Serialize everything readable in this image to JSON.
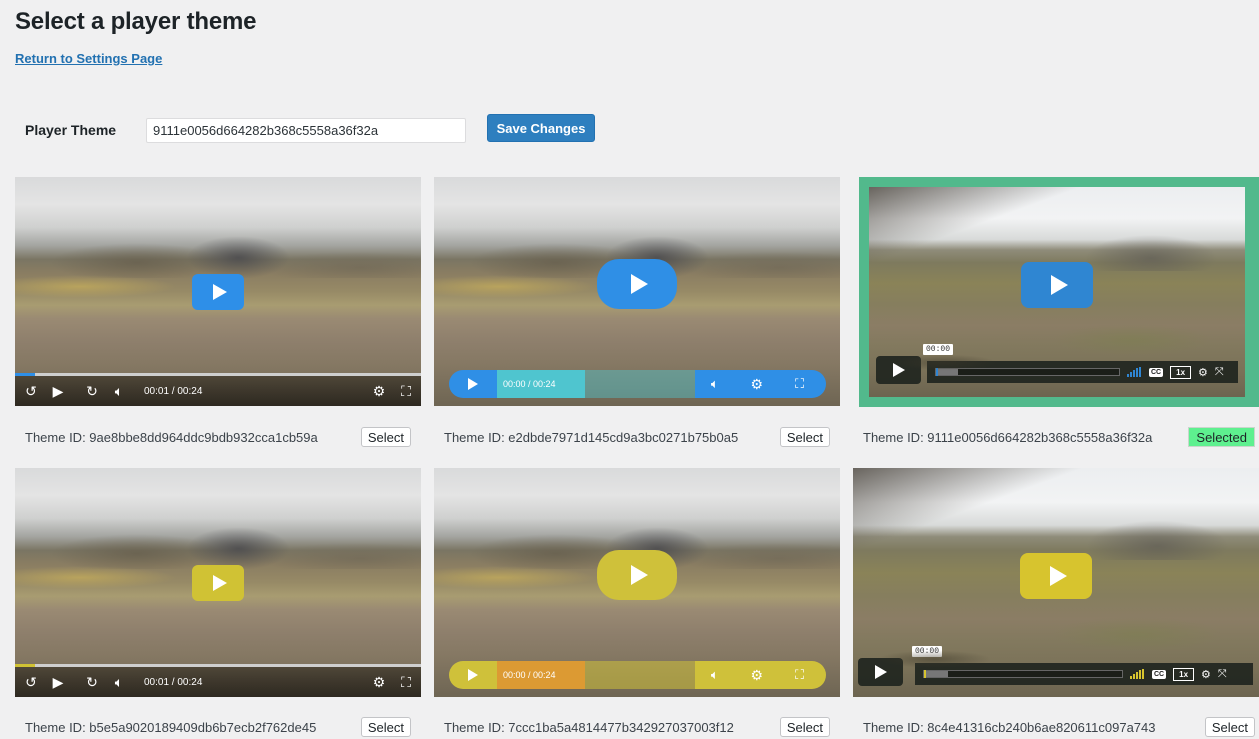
{
  "page": {
    "title": "Select a player theme",
    "back_link": "Return to Settings Page"
  },
  "form": {
    "label": "Player Theme",
    "value": "9111e0056d664282b368c5558a36f32a",
    "save_label": "Save Changes"
  },
  "colors": {
    "blue": "#2e8fe8",
    "blue_pill": "#2f8fe6",
    "teal": "#4fc5cf",
    "yellow": "#d0c234",
    "yellow_pill": "#cfc13a",
    "orange": "#dc9a33",
    "vimeo_blue": "#2f86d2",
    "vimeo_yellow": "#d7c42e",
    "selected_frame": "#52b98c",
    "selected_badge": "#5ef08f"
  },
  "themes": [
    {
      "id_label": "Theme ID: 9ae8bbe8dd964ddc9bdb932cca1cb59a",
      "action": "Select",
      "style": "plyr-classic",
      "accent": "blue",
      "time": "00:01 / 00:24",
      "progress": 0.05,
      "icons": [
        "rewind-icon",
        "play-icon",
        "forward-icon",
        "volume-icon",
        "gear-icon",
        "fullscreen-icon"
      ]
    },
    {
      "id_label": "Theme ID: e2dbde7971d145cd9a3bc0271b75b0a5",
      "action": "Select",
      "style": "pill",
      "accent": "blue",
      "time": "00:00 / 00:24",
      "progress": 0,
      "icons": [
        "play-icon",
        "volume-icon",
        "gear-icon",
        "fullscreen-icon"
      ]
    },
    {
      "id_label": "Theme ID: 9111e0056d664282b368c5558a36f32a",
      "action": "Selected",
      "selected": true,
      "style": "vimeo",
      "accent": "blue",
      "tooltip": "00:00",
      "rate": "1x",
      "cc": "CC",
      "progress": 0,
      "icons": [
        "play-icon",
        "volume-bars-icon",
        "cc-icon",
        "gear-icon",
        "fullscreen-icon"
      ]
    },
    {
      "id_label": "Theme ID: b5e5a9020189409db6b7ecb2f762de45",
      "action": "Select",
      "style": "plyr-classic",
      "accent": "yellow",
      "time": "00:01 / 00:24",
      "progress": 0.05,
      "icons": [
        "rewind-icon",
        "play-icon",
        "forward-icon",
        "volume-icon",
        "gear-icon",
        "fullscreen-icon"
      ]
    },
    {
      "id_label": "Theme ID: 7ccc1ba5a4814477b342927037003f12",
      "action": "Select",
      "style": "pill",
      "accent": "yellow",
      "time": "00:00 / 00:24",
      "progress": 0,
      "icons": [
        "play-icon",
        "volume-icon",
        "gear-icon",
        "fullscreen-icon"
      ]
    },
    {
      "id_label": "Theme ID: 8c4e41316cb240b6ae820611c097a743",
      "action": "Select",
      "style": "vimeo",
      "accent": "yellow",
      "tooltip": "00:00",
      "rate": "1x",
      "cc": "CC",
      "progress": 0,
      "icons": [
        "play-icon",
        "volume-bars-icon",
        "cc-icon",
        "gear-icon",
        "fullscreen-icon"
      ]
    }
  ]
}
